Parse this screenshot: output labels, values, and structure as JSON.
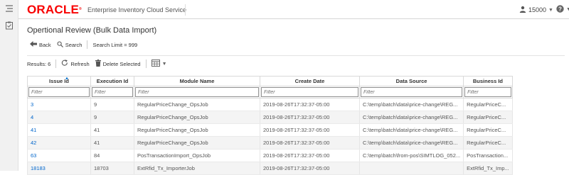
{
  "header": {
    "logo_text": "ORACLE",
    "logo_reg": "®",
    "app_title": "Enterprise Inventory Cloud Service",
    "user_label": "15000",
    "help_label": "?"
  },
  "page": {
    "title": "Opertional Review (Bulk Data Import)"
  },
  "toolbar": {
    "back_label": "Back",
    "search_label": "Search",
    "search_limit": "Search Limit = 999"
  },
  "table_toolbar": {
    "results_label": "Results: 6",
    "refresh_label": "Refresh",
    "delete_label": "Delete Selected"
  },
  "table": {
    "columns": [
      "Issue Id",
      "Execution Id",
      "Module Name",
      "Create Date",
      "Data Source",
      "Business Id"
    ],
    "filter_placeholder": "Filter",
    "rows": [
      [
        "3",
        "9",
        "RegularPriceChange_OpsJob",
        "2019-08-26T17:32:37-05:00",
        "C:\\temp\\batch\\data\\price-change\\REG...",
        "RegularPriceC..."
      ],
      [
        "4",
        "9",
        "RegularPriceChange_OpsJob",
        "2019-08-26T17:32:37-05:00",
        "C:\\temp\\batch\\data\\price-change\\REG...",
        "RegularPriceC..."
      ],
      [
        "41",
        "41",
        "RegularPriceChange_OpsJob",
        "2019-08-26T17:32:37-05:00",
        "C:\\temp\\batch\\data\\price-change\\REG...",
        "RegularPriceC..."
      ],
      [
        "42",
        "41",
        "RegularPriceChange_OpsJob",
        "2019-08-26T17:32:37-05:00",
        "C:\\temp\\batch\\data\\price-change\\REG...",
        "RegularPriceC..."
      ],
      [
        "63",
        "84",
        "PosTransactionImport_OpsJob",
        "2019-08-26T17:32:37-05:00",
        "C:\\temp\\batch\\from-pos\\SIMTLOG_052...",
        "PosTransaction..."
      ],
      [
        "18183",
        "18703",
        "ExtRfid_Tx_ImporterJob",
        "2019-08-26T17:32:37-05:00",
        "",
        "ExtRfid_Tx_Imp..."
      ]
    ]
  },
  "colors": {
    "oracle_red": "#f80000",
    "link_blue": "#0066cc",
    "sort_blue": "#0572ce"
  }
}
